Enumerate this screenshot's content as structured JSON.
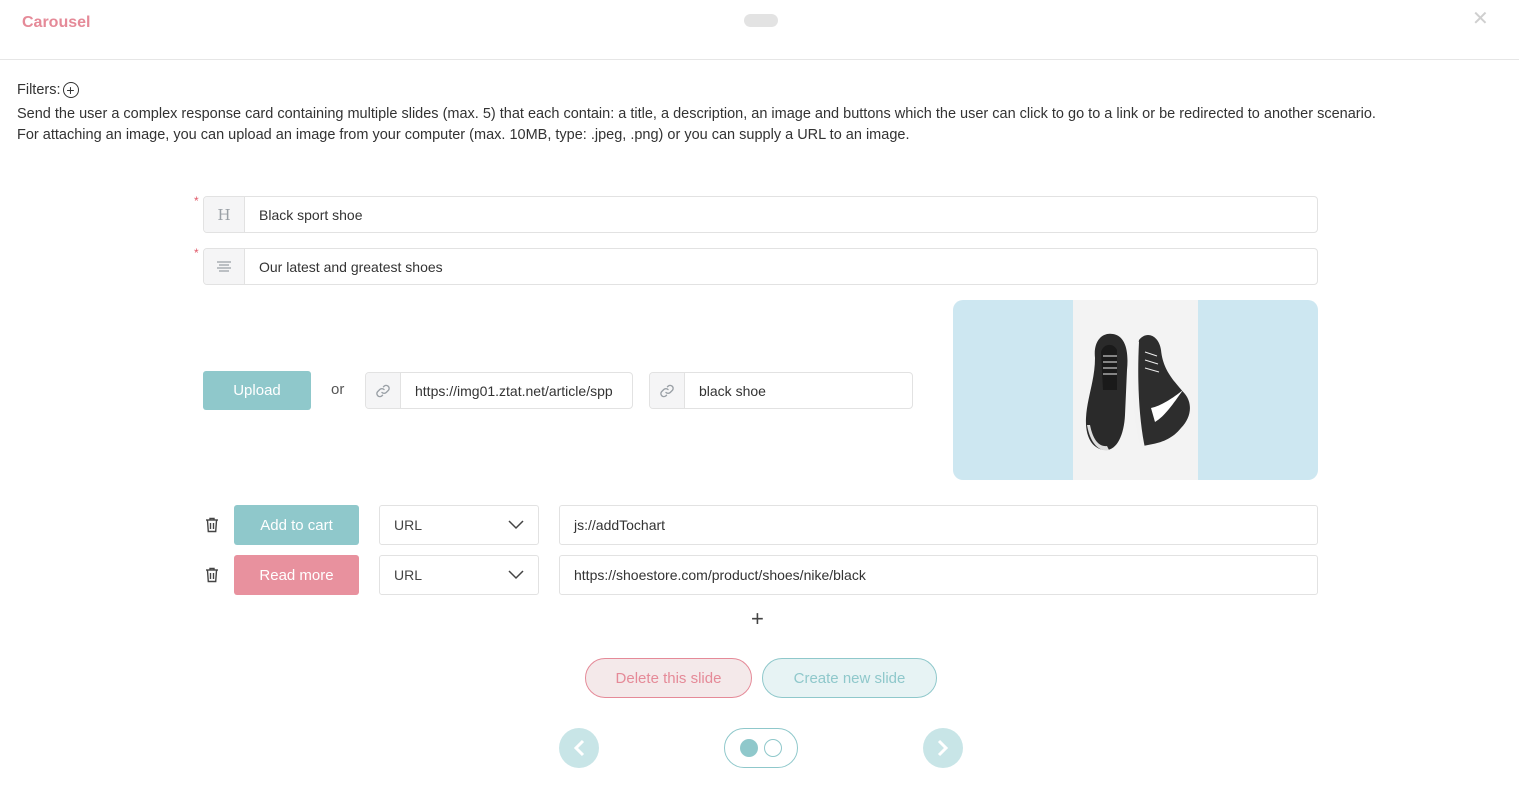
{
  "header": {
    "title": "Carousel"
  },
  "filters": {
    "label": "Filters:"
  },
  "description": {
    "line1": "Send the user a complex response card containing multiple slides (max. 5) that each contain: a title, a description, an image and buttons which the user can click to go to a link or be redirected to another scenario.",
    "line2": "For attaching an image, you can upload an image from your computer (max. 10MB, type: .jpeg, .png) or you can supply a URL to an image."
  },
  "slide": {
    "title_value": "Black sport shoe",
    "description_value": "Our latest and greatest shoes",
    "upload_label": "Upload",
    "or_label": "or",
    "image_url": "https://img01.ztat.net/article/spp",
    "image_alt": "black shoe",
    "buttons": [
      {
        "label": "Add to cart",
        "type": "URL",
        "value": "js://addTochart",
        "color": "#8fc8cb"
      },
      {
        "label": "Read more",
        "type": "URL",
        "value": "https://shoestore.com/product/shoes/nike/black",
        "color": "#e8919e"
      }
    ]
  },
  "actions": {
    "delete_label": "Delete this slide",
    "create_label": "Create new slide"
  },
  "pagination": {
    "current": 1,
    "total": 2
  },
  "colors": {
    "accent_teal": "#8fc8cb",
    "accent_pink": "#e58a98"
  }
}
